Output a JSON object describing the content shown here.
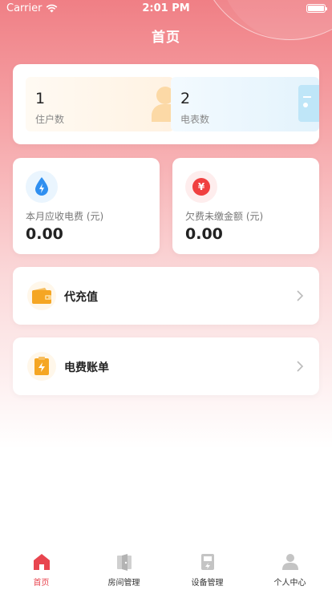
{
  "status": {
    "carrier": "Carrier",
    "time": "2:01 PM"
  },
  "nav": {
    "title": "首页"
  },
  "summary": {
    "residents": {
      "value": "1",
      "label": "住户数"
    },
    "meters": {
      "value": "2",
      "label": "电表数"
    }
  },
  "fees": {
    "monthly": {
      "label": "本月应收电费 (元)",
      "value": "0.00",
      "icon": "water-drop-bolt-icon",
      "color": "#2f8ff0"
    },
    "unpaid": {
      "label": "欠费未缴金额 (元)",
      "value": "0.00",
      "icon": "yuan-icon",
      "color": "#f04040"
    }
  },
  "rows": [
    {
      "label": "代充值",
      "icon": "wallet-icon"
    },
    {
      "label": "电费账单",
      "icon": "bill-icon"
    }
  ],
  "tabs": [
    {
      "label": "首页",
      "icon": "home-icon",
      "active": true
    },
    {
      "label": "房间管理",
      "icon": "door-icon",
      "active": false
    },
    {
      "label": "设备管理",
      "icon": "device-icon",
      "active": false
    },
    {
      "label": "个人中心",
      "icon": "user-icon",
      "active": false
    }
  ],
  "colors": {
    "accent": "#e8454f",
    "wallet": "#f5a623"
  }
}
